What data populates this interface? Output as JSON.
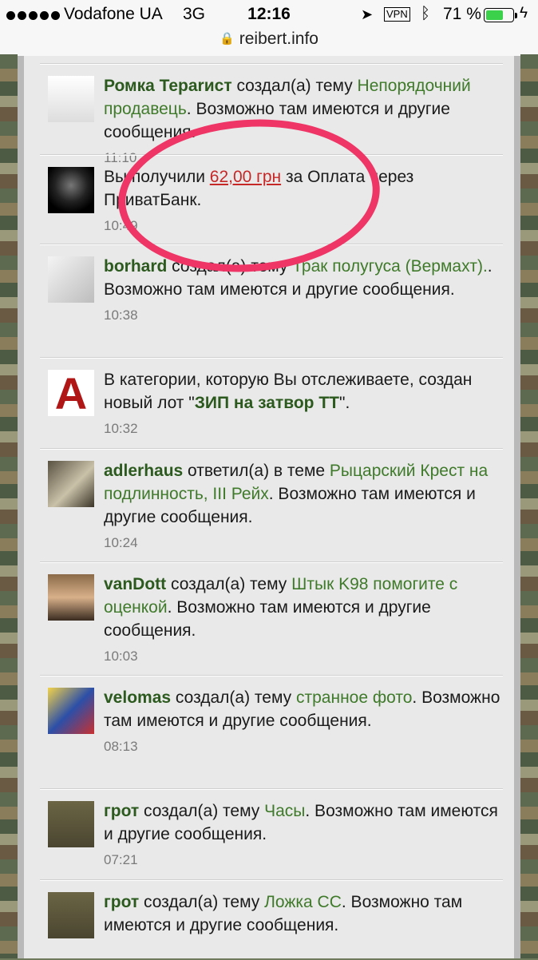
{
  "status_bar": {
    "carrier": "Vodafone UA",
    "network": "3G",
    "time": "12:16",
    "vpn": "VPN",
    "battery_percent": "71 %",
    "battery_level": 0.71,
    "url": "reibert.info"
  },
  "feed": [
    {
      "user": "Ромка Тераrист",
      "action": " создал(а) тему ",
      "topic": "Непорядочний продавець",
      "suffix": ". Возможно там имеются и другие сообщения.",
      "time": "11:10",
      "avatar_icon": "statue-of-liberty-avatar-icon"
    },
    {
      "prefix": "Вы получили ",
      "amount": "62,00 грн",
      "suffix": " за Оплата через ПриватБанк.",
      "time": "10:49",
      "avatar_icon": "reaper-avatar-icon"
    },
    {
      "user": "borhard",
      "action": " создал(а) тему ",
      "topic": "Трак полугуса (Вермахт).",
      "suffix": ". Возможно там имеются и другие сообщения.",
      "time": "10:38",
      "avatar_icon": "sketch-avatar-icon"
    },
    {
      "prefix": "В категории, которую Вы отслеживаете, создан новый лот \"",
      "lot": "ЗИП на затвор ТТ",
      "suffix": "\".",
      "time": "10:32",
      "avatar_icon": "letter-a-avatar-icon",
      "avatar_letter": "A"
    },
    {
      "user": "adlerhaus",
      "action": " ответил(а) в теме ",
      "topic": "Рыцарский Крест на подлинность, III Рейх",
      "suffix": ". Возможно там имеются и другие сообщения.",
      "time": "10:24",
      "avatar_icon": "eagle-avatar-icon"
    },
    {
      "user": "vanDott",
      "action": " создал(а) тему ",
      "topic": "Штык K98 помогите с оценкой",
      "suffix": ". Возможно там имеются и другие сообщения.",
      "time": "10:03",
      "avatar_icon": "portrait-avatar-icon"
    },
    {
      "user": "velomas",
      "action": " создал(а) тему ",
      "topic": "странное фото",
      "suffix": ". Возможно там имеются и другие сообщения.",
      "time": "08:13",
      "avatar_icon": "coat-of-arms-avatar-icon"
    },
    {
      "user": "грот",
      "action": " создал(а) тему ",
      "topic": "Часы",
      "suffix": ". Возможно там имеются и другие сообщения.",
      "time": "07:21",
      "avatar_icon": "iron-cross-avatar-icon"
    },
    {
      "user": "грот",
      "action": " создал(а) тему ",
      "topic": "Ложка СС",
      "suffix": ". Возможно там имеются и другие сообщения.",
      "time": "",
      "avatar_icon": "iron-cross-avatar-icon"
    }
  ],
  "colors": {
    "highlight": "#ef3566",
    "user": "#2c5a1e",
    "topic": "#3f7a2a",
    "amount": "#c62828"
  }
}
